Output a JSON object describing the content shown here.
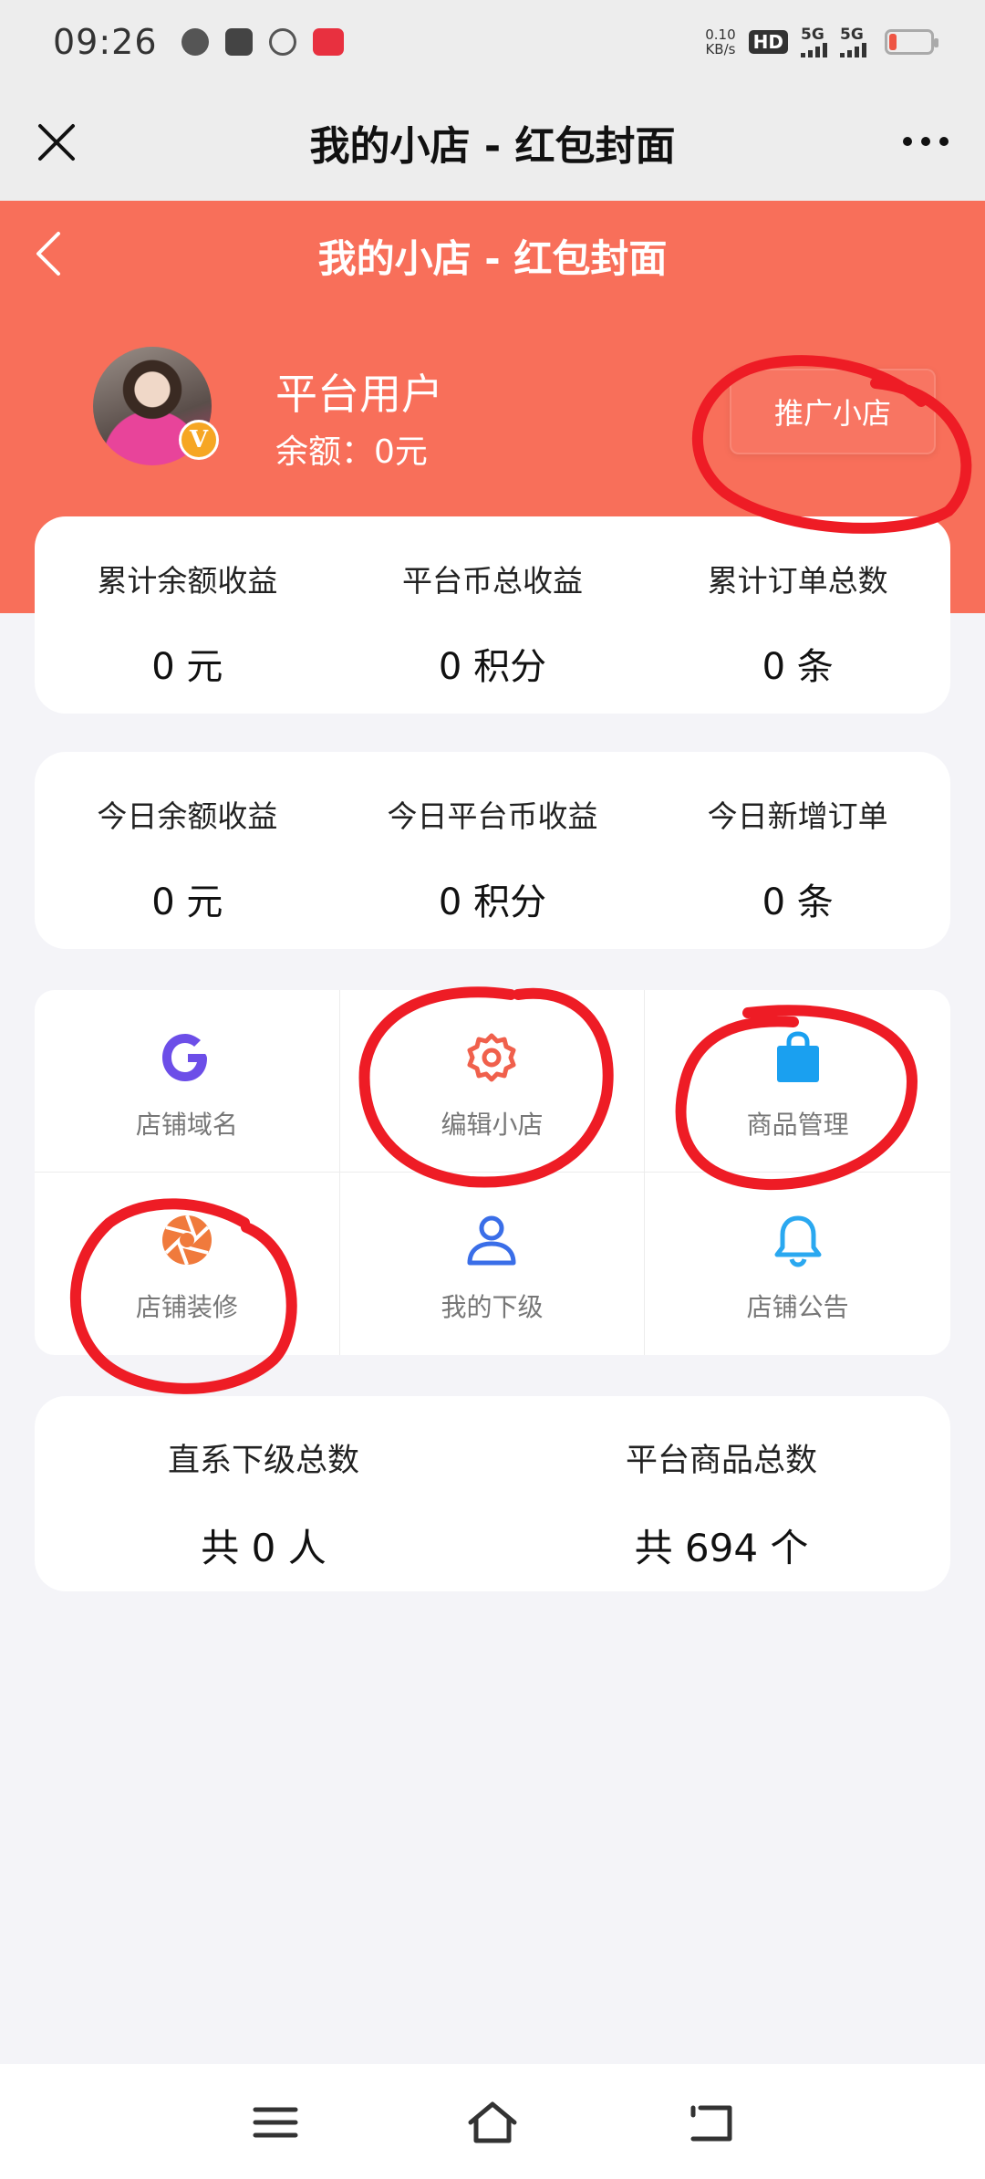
{
  "status_bar": {
    "time": "09:26",
    "net_speed_value": "0.10",
    "net_speed_unit": "KB/s",
    "hd_badge": "HD",
    "sim1_label": "5G",
    "sim2_label": "5G"
  },
  "nav": {
    "title": "我的小店 - 红包封面"
  },
  "header": {
    "title": "我的小店 - 红包封面",
    "user_name": "平台用户",
    "balance": "余额：0元",
    "vip_badge": "V",
    "promote_button": "推广小店",
    "accent_color": "#f86f5a"
  },
  "total_stats": [
    {
      "label": "累计余额收益",
      "value": "0 元"
    },
    {
      "label": "平台币总收益",
      "value": "0 积分"
    },
    {
      "label": "累计订单总数",
      "value": "0 条"
    }
  ],
  "today_stats": [
    {
      "label": "今日余额收益",
      "value": "0 元"
    },
    {
      "label": "今日平台币收益",
      "value": "0 积分"
    },
    {
      "label": "今日新增订单",
      "value": "0 条"
    }
  ],
  "menu": [
    {
      "label": "店铺域名",
      "icon": "google-g-icon",
      "color": "#6c4ee8"
    },
    {
      "label": "编辑小店",
      "icon": "gear-icon",
      "color": "#f0604c"
    },
    {
      "label": "商品管理",
      "icon": "shopping-bag-icon",
      "color": "#1aa0f0"
    },
    {
      "label": "店铺装修",
      "icon": "aperture-icon",
      "color": "#f07a3c"
    },
    {
      "label": "我的下级",
      "icon": "user-icon",
      "color": "#3a6ee8"
    },
    {
      "label": "店铺公告",
      "icon": "bell-icon",
      "color": "#2aa8f0"
    }
  ],
  "bottom_stats": [
    {
      "label": "直系下级总数",
      "value": "共 0 人"
    },
    {
      "label": "平台商品总数",
      "value": "共 694 个"
    }
  ]
}
